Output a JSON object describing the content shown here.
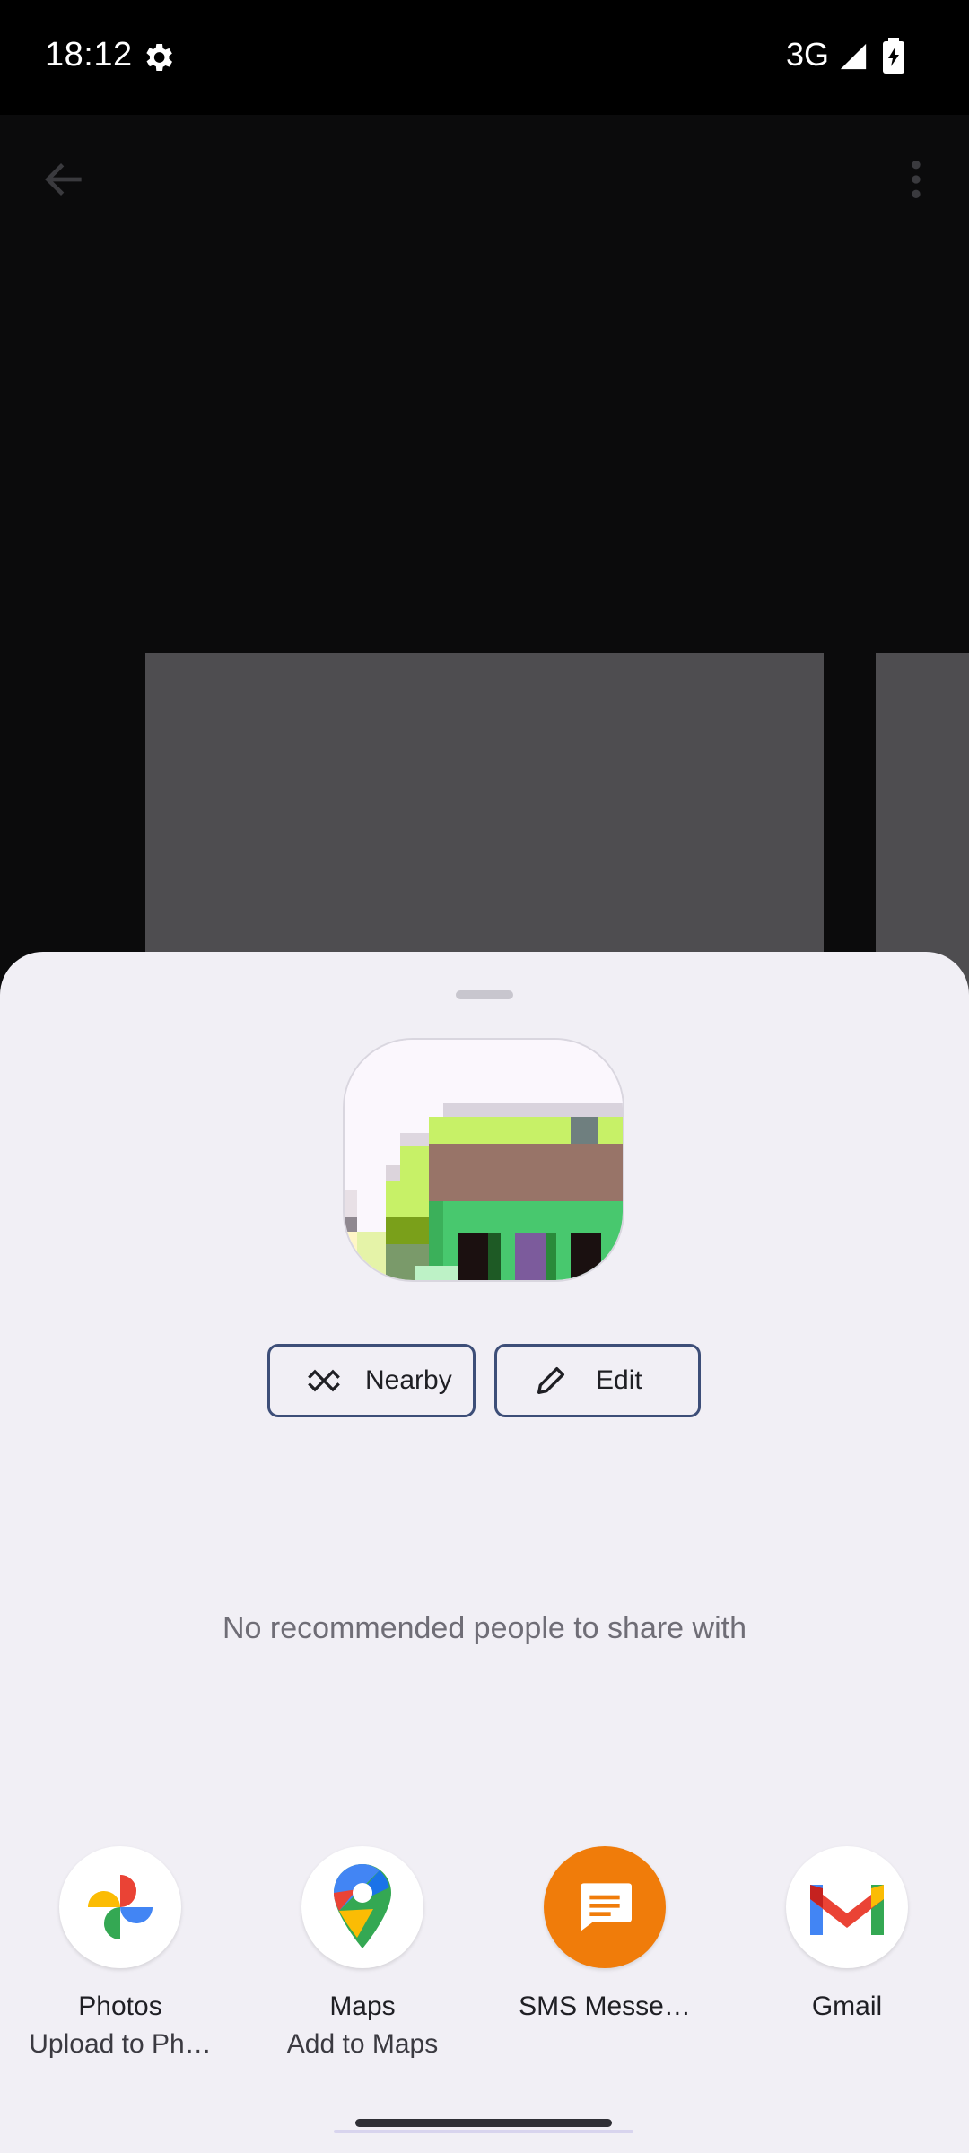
{
  "status_bar": {
    "time": "18:12",
    "network": "3G",
    "icons": [
      "settings-gear-icon",
      "signal-icon",
      "battery-charging-icon"
    ]
  },
  "toolbar": {
    "icons": [
      "back-arrow-icon",
      "more-vert-icon"
    ]
  },
  "share_sheet": {
    "actions": {
      "nearby_label": "Nearby",
      "edit_label": "Edit"
    },
    "empty_people_text": "No recommended people to share with",
    "apps": [
      {
        "name": "Photos",
        "subtitle": "Upload to Ph…",
        "icon": "google-photos-icon"
      },
      {
        "name": "Maps",
        "subtitle": "Add to Maps",
        "icon": "google-maps-icon"
      },
      {
        "name": "SMS Messe…",
        "subtitle": "",
        "icon": "sms-messages-icon"
      },
      {
        "name": "Gmail",
        "subtitle": "",
        "icon": "gmail-icon"
      }
    ]
  },
  "colors": {
    "sheet_bg": "#f1eff5",
    "chip_border": "#3d4e78",
    "sms_orange": "#f07c0a"
  }
}
